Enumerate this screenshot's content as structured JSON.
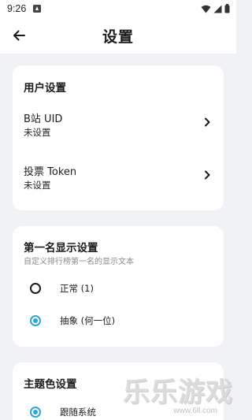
{
  "statusbar": {
    "time": "9:26"
  },
  "header": {
    "title": "设置"
  },
  "user_settings": {
    "title": "用户设置",
    "items": [
      {
        "label": "B站 UID",
        "value": "未设置"
      },
      {
        "label": "投票 Token",
        "value": "未设置"
      }
    ]
  },
  "rank_display": {
    "title": "第一名显示设置",
    "subtitle": "自定义排行榜第一名的显示文本",
    "options": [
      {
        "label": "正常 (1)",
        "selected": false
      },
      {
        "label": "抽象 (何一位)",
        "selected": true
      }
    ]
  },
  "theme_settings": {
    "title": "主题色设置",
    "options": [
      {
        "label": "跟随系统",
        "selected": true
      }
    ]
  },
  "watermark": {
    "text": "乐乐游戏",
    "url": "www.6ll.com"
  },
  "colors": {
    "accent": "#2aa6d9",
    "background": "#f1f2f5",
    "card": "#ffffff"
  }
}
